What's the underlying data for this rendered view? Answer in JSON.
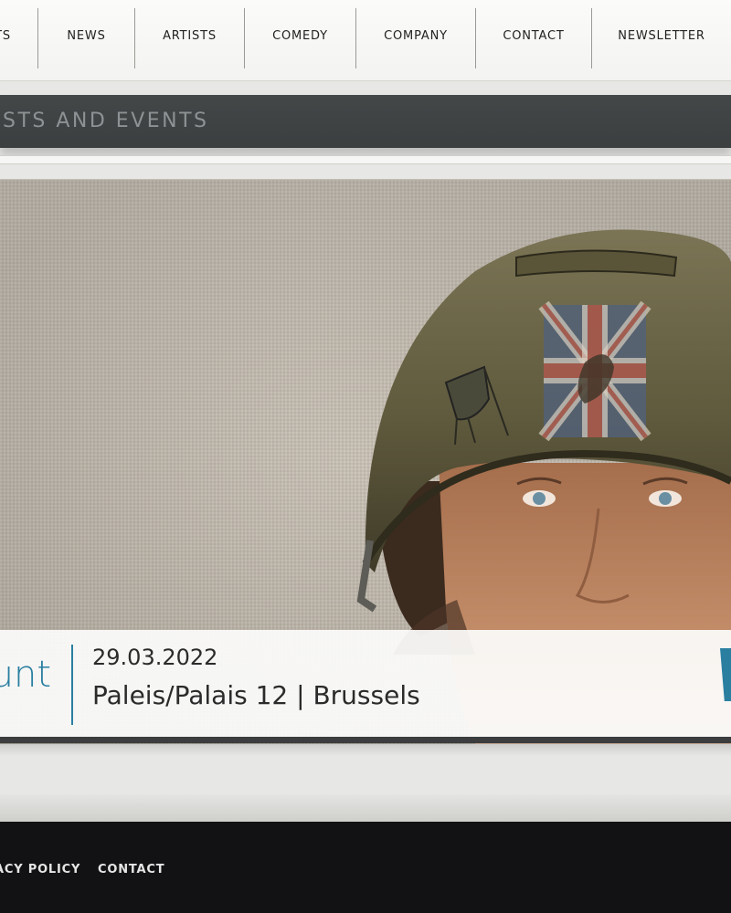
{
  "nav": {
    "items": [
      "TS",
      "NEWS",
      "ARTISTS",
      "COMEDY",
      "COMPANY",
      "CONTACT",
      "NEWSLETTER"
    ]
  },
  "banner": {
    "text": "ISTS AND EVENTS"
  },
  "event": {
    "artist": "unt",
    "date": "29.03.2022",
    "venue": "Paleis/Palais 12 | Brussels"
  },
  "footer": {
    "links": [
      "ACY POLICY",
      "CONTACT"
    ]
  },
  "colors": {
    "accent": "#2a7fa1",
    "banner_bg": "#3f4344",
    "footer_bg": "#121214"
  }
}
